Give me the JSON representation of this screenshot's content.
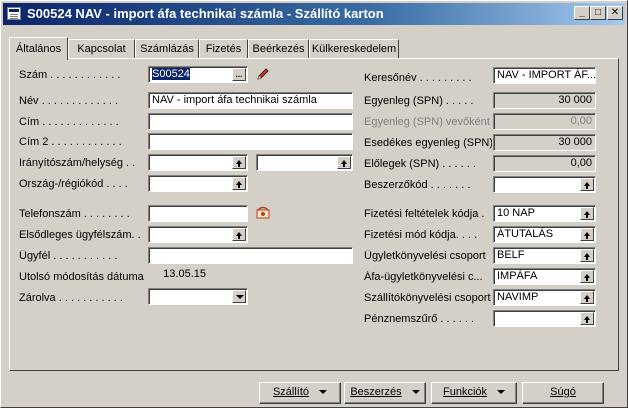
{
  "window": {
    "title": "S00524 NAV - import áfa technikai számla - Szállító karton"
  },
  "tabs": [
    "Általános",
    "Kapcsolat",
    "Számlázás",
    "Fizetés",
    "Beérkezés",
    "Külkereskedelem"
  ],
  "left": {
    "szam": {
      "label": "Szám . . . . . . . . . . . .",
      "value": "S00524"
    },
    "nev": {
      "label": "Név . . . . . . . . . . . . .",
      "value": "NAV - import áfa technikai számla"
    },
    "cim": {
      "label": "Cím . . . . . . . . . . . . .",
      "value": ""
    },
    "cim2": {
      "label": "Cím 2 . . . . . . . . . . . .",
      "value": ""
    },
    "irsz": {
      "label": "Irányítószám/helység . .",
      "value": "",
      "value2": ""
    },
    "orszag": {
      "label": "Ország-/régiókód . . . .",
      "value": ""
    },
    "telefon": {
      "label": "Telefonszám . . . . . . . .",
      "value": ""
    },
    "elsodleges": {
      "label": "Elsődleges ügyfélszám. .",
      "value": ""
    },
    "ugyfel": {
      "label": "Ügyfél . . . . . . . . . . .",
      "value": ""
    },
    "utolso": {
      "label": "Utolsó módosítás dátuma",
      "value": "13.05.15"
    },
    "zarolva": {
      "label": "Zárolva . . . . . . . . . . .",
      "value": ""
    }
  },
  "right": {
    "keresonev": {
      "label": "Keresőnév . . . . . . . . .",
      "value": "NAV - IMPORT ÁF..."
    },
    "egyenleg": {
      "label": "Egyenleg (SPN) . . . . .",
      "value": "30 000"
    },
    "egyenleg_vevo": {
      "label": "Egyenleg (SPN) vevőként",
      "value": "0,00"
    },
    "esedekes": {
      "label": "Esedékes egyenleg (SPN)",
      "value": "30 000"
    },
    "elolegek": {
      "label": "Előlegek (SPN) . . . . . .",
      "value": "0,00"
    },
    "beszerzokod": {
      "label": "Beszerzőkód . . . . . . .",
      "value": ""
    },
    "fiz_felt": {
      "label": "Fizetési feltételek kódja .",
      "value": "10 NAP"
    },
    "fiz_mod": {
      "label": "Fizetési mód kódja. . . .",
      "value": "ÁTUTALÁS"
    },
    "ugyletkonyv": {
      "label": "Ügyletkönyvelési csoport",
      "value": "BELF"
    },
    "afa_ugylet": {
      "label": "Áfa-ügyletkönyvelési c...",
      "value": "IMPÁFA"
    },
    "szallito_konyv": {
      "label": "Szállítókönyvelési csoport",
      "value": "NAVIMP"
    },
    "penznem": {
      "label": "Pénznemszűrő . . . . . .",
      "value": ""
    }
  },
  "buttons": {
    "szallito": "Szállító",
    "beszerzes": "Beszerzés",
    "funkciok": "Funkciók",
    "sugo": "Súgó"
  },
  "icons": [
    "app-icon",
    "minimize-icon",
    "maximize-icon",
    "close-icon",
    "edit-pencil-icon",
    "phone-dial-icon"
  ]
}
